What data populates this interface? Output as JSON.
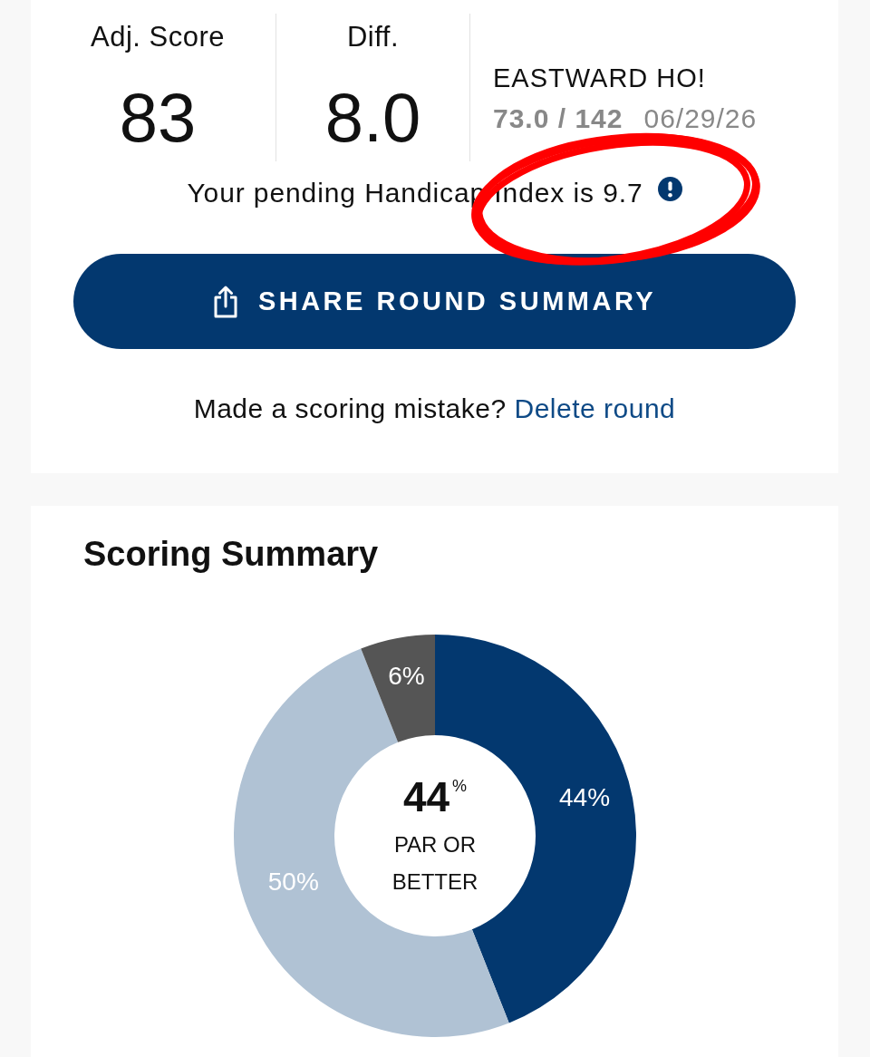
{
  "round_summary": {
    "stats": [
      {
        "label": "Adj. Score",
        "value": "83"
      },
      {
        "label": "Diff.",
        "value": "8.0"
      }
    ],
    "course": {
      "name": "EASTWARD HO!",
      "rating_slope": "73.0 / 142",
      "date": "06/29/26"
    },
    "handicap_notice": "Your pending Handicap Index is 9.7",
    "share_button": "SHARE ROUND SUMMARY",
    "delete_prompt": {
      "text": "Made a scoring mistake?",
      "link": "Delete round"
    }
  },
  "scoring_summary": {
    "title": "Scoring Summary",
    "chart_data": {
      "type": "donut",
      "values": [
        44,
        50,
        6
      ],
      "value_labels": [
        "44%",
        "50%",
        "6%"
      ],
      "colors": [
        "#03386f",
        "#b0c2d4",
        "#555555"
      ]
    },
    "center_value": "44$^{%}$",
    "center_label": "PAR OR BETTER"
  }
}
